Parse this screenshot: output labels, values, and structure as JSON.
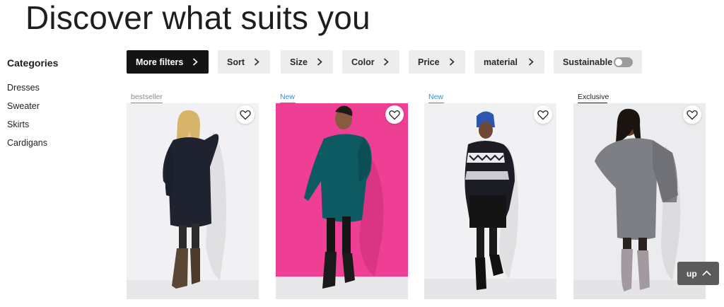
{
  "page_title": "Discover what suits you",
  "sidebar": {
    "heading": "Categories",
    "items": [
      "Dresses",
      "Sweater",
      "Skirts",
      "Cardigans"
    ]
  },
  "filters": {
    "more_filters": "More filters",
    "sort": "Sort",
    "size": "Size",
    "color": "Color",
    "price": "Price",
    "material": "material",
    "sustainable": "Sustainable",
    "sustainable_enabled": false
  },
  "products": [
    {
      "badge": "bestseller",
      "badge_color": "#8a8a8a",
      "image": "woman in black knit sweater dress with brown boots",
      "background": "#f1f1f3"
    },
    {
      "badge": "New",
      "badge_color": "#3b8fc9",
      "image": "woman in teal oversized sweater dress on pink backdrop",
      "background": "#ef3f94"
    },
    {
      "badge": "New",
      "badge_color": "#3b8fc9",
      "image": "woman in nordic pattern knit dress with blue beanie",
      "background": "#f1f1f3"
    },
    {
      "badge": "Exclusive",
      "badge_color": "#222222",
      "image": "woman in grey knit dress with poncho and grey boots",
      "background": "#ececee"
    }
  ],
  "up_button": "up",
  "icons": [
    "chevron-right-icon",
    "heart-icon",
    "chevron-up-icon"
  ]
}
